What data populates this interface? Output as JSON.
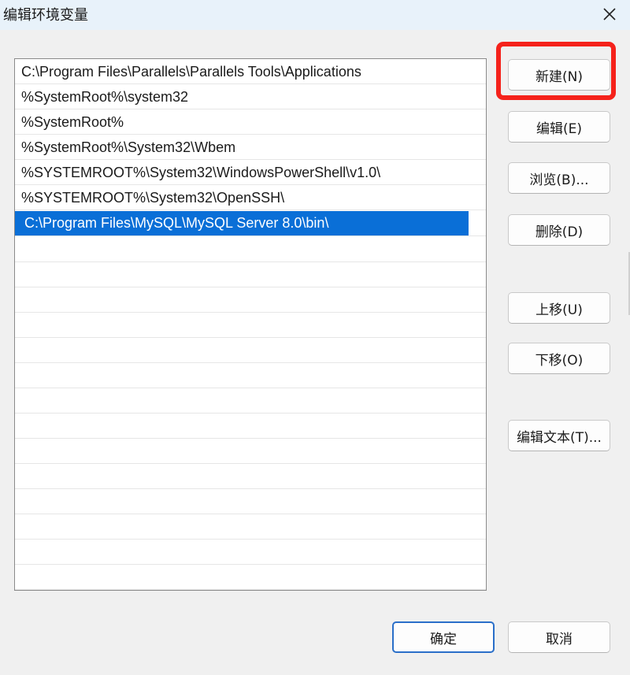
{
  "window": {
    "title": "编辑环境变量",
    "close_icon": "close-icon"
  },
  "path_list": {
    "items": [
      {
        "text": "C:\\Program Files\\Parallels\\Parallels Tools\\Applications",
        "selected": false
      },
      {
        "text": "%SystemRoot%\\system32",
        "selected": false
      },
      {
        "text": "%SystemRoot%",
        "selected": false
      },
      {
        "text": "%SystemRoot%\\System32\\Wbem",
        "selected": false
      },
      {
        "text": "%SYSTEMROOT%\\System32\\WindowsPowerShell\\v1.0\\",
        "selected": false
      },
      {
        "text": "%SYSTEMROOT%\\System32\\OpenSSH\\",
        "selected": false
      },
      {
        "text": "C:\\Program Files\\MySQL\\MySQL Server 8.0\\bin\\",
        "selected": true
      }
    ],
    "selection_color": "#0a6fd7"
  },
  "buttons": {
    "new": "新建(N)",
    "edit": "编辑(E)",
    "browse": "浏览(B)...",
    "delete": "删除(D)",
    "move_up": "上移(U)",
    "move_down": "下移(O)",
    "edit_text": "编辑文本(T)...",
    "ok": "确定",
    "cancel": "取消"
  },
  "annotation": {
    "highlight_color": "#f5221b",
    "highlighted_button": "new"
  }
}
